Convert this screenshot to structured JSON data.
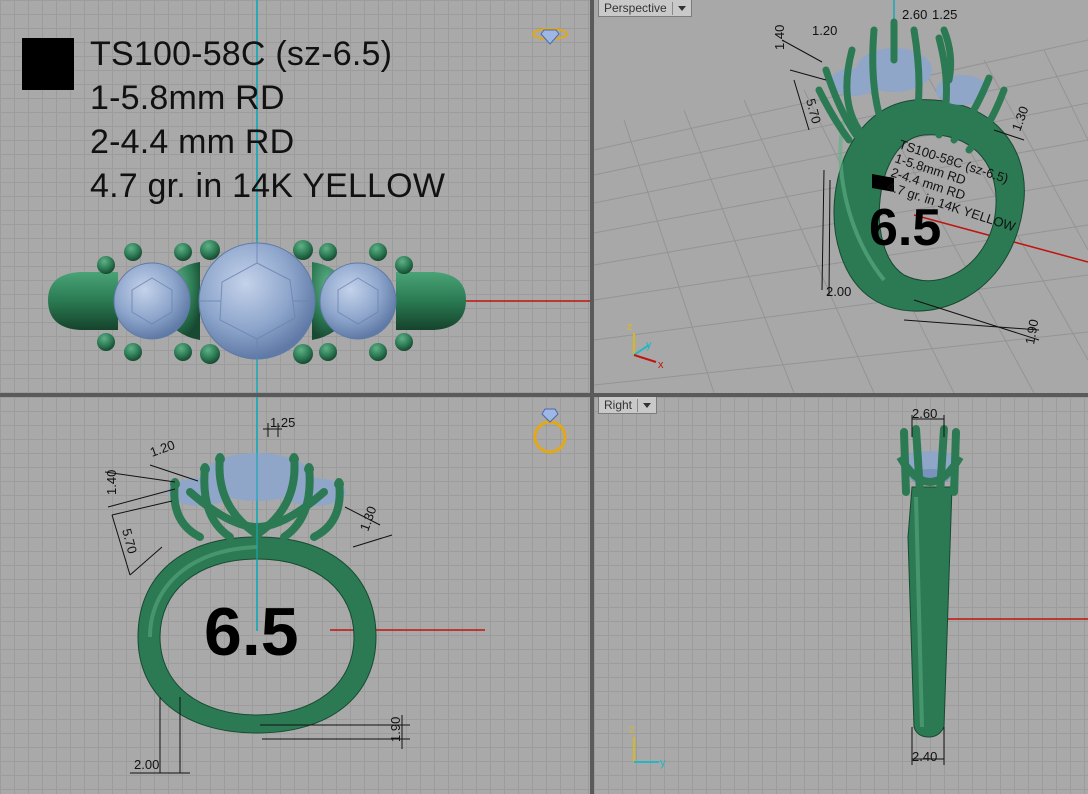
{
  "viewports": {
    "perspective": {
      "label": "Perspective"
    },
    "right": {
      "label": "Right"
    }
  },
  "spec": {
    "model": "TS100-58C (sz-6.5)",
    "center_stone": "1-5.8mm RD",
    "side_stones": "2-4.4 mm RD",
    "weight_metal": "4.7 gr. in  14K YELLOW"
  },
  "ring_size": "6.5",
  "dimensions": {
    "d_125": "1.25",
    "d_120": "1.20",
    "d_140": "1.40",
    "d_570": "5.70",
    "d_130": "1.30",
    "d_190": "1.90",
    "d_200": "2.00",
    "d_260": "2.60",
    "d_240": "2.40"
  },
  "axes": {
    "x": "x",
    "y": "y",
    "z": "z"
  },
  "colors": {
    "metal": "#2f7a55",
    "stone": "#8fa6c8",
    "axis_red": "#c0140e",
    "axis_cyan": "#18a7b5",
    "grid_bg": "#a9a9a9"
  },
  "icons": [
    "ring-gem-icon",
    "ring-icon"
  ]
}
